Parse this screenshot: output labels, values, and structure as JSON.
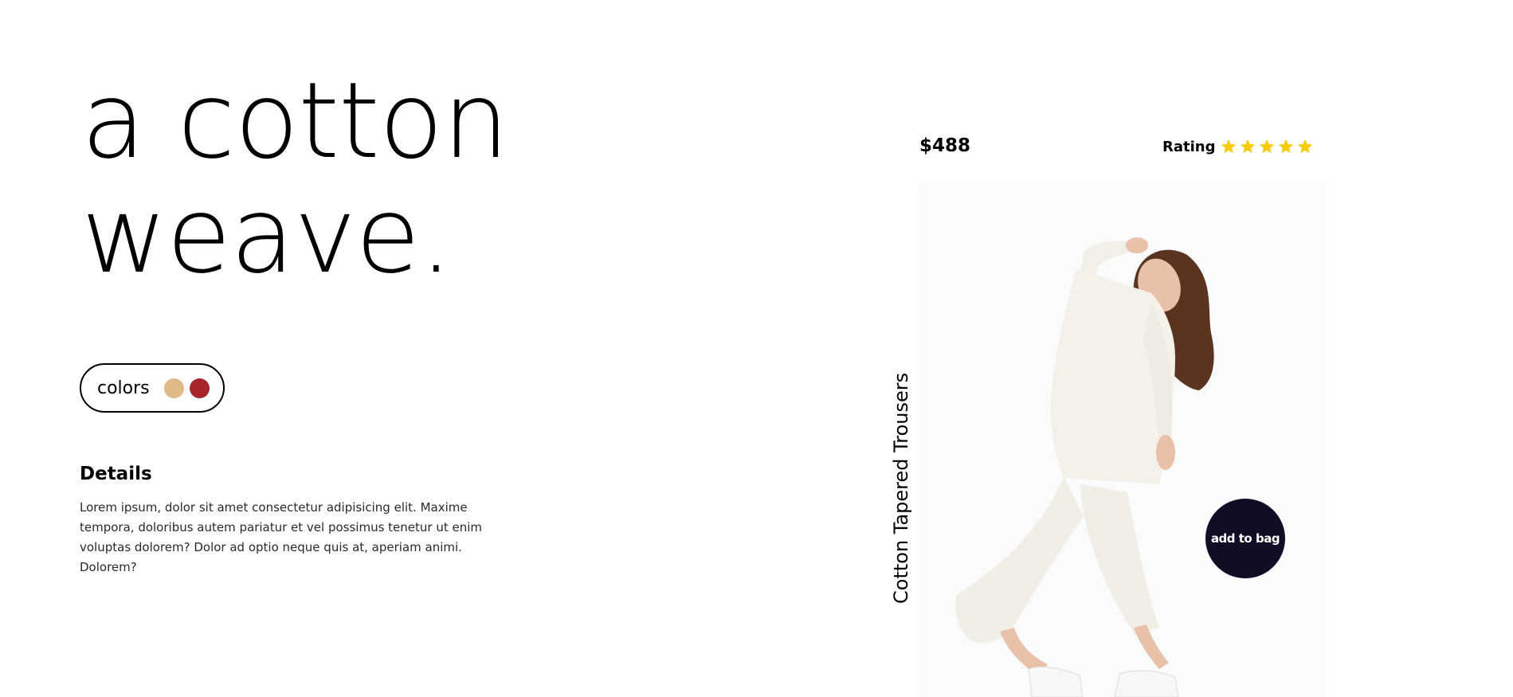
{
  "headline": {
    "line1": "a cotton",
    "line2": "weave."
  },
  "colors": {
    "label": "colors",
    "swatches": [
      {
        "name": "sand",
        "color": "#dfb988"
      },
      {
        "name": "red",
        "color": "#a6262a"
      }
    ]
  },
  "details": {
    "title": "Details",
    "text": "Lorem ipsum, dolor sit amet consectetur adipisicing elit. Maxime tempora, doloribus autem pariatur et vel possimus tenetur ut enim voluptas dolorem? Dolor ad optio neque quis at, aperiam animi. Dolorem?"
  },
  "product": {
    "price": "$488",
    "rating_label": "Rating",
    "rating_value": 5,
    "rating_max": 5,
    "star_color": "#f9cc0b",
    "name": "Cotton Tapered Trousers",
    "add_to_bag_label": "add to bag",
    "button_color": "#110d25"
  }
}
